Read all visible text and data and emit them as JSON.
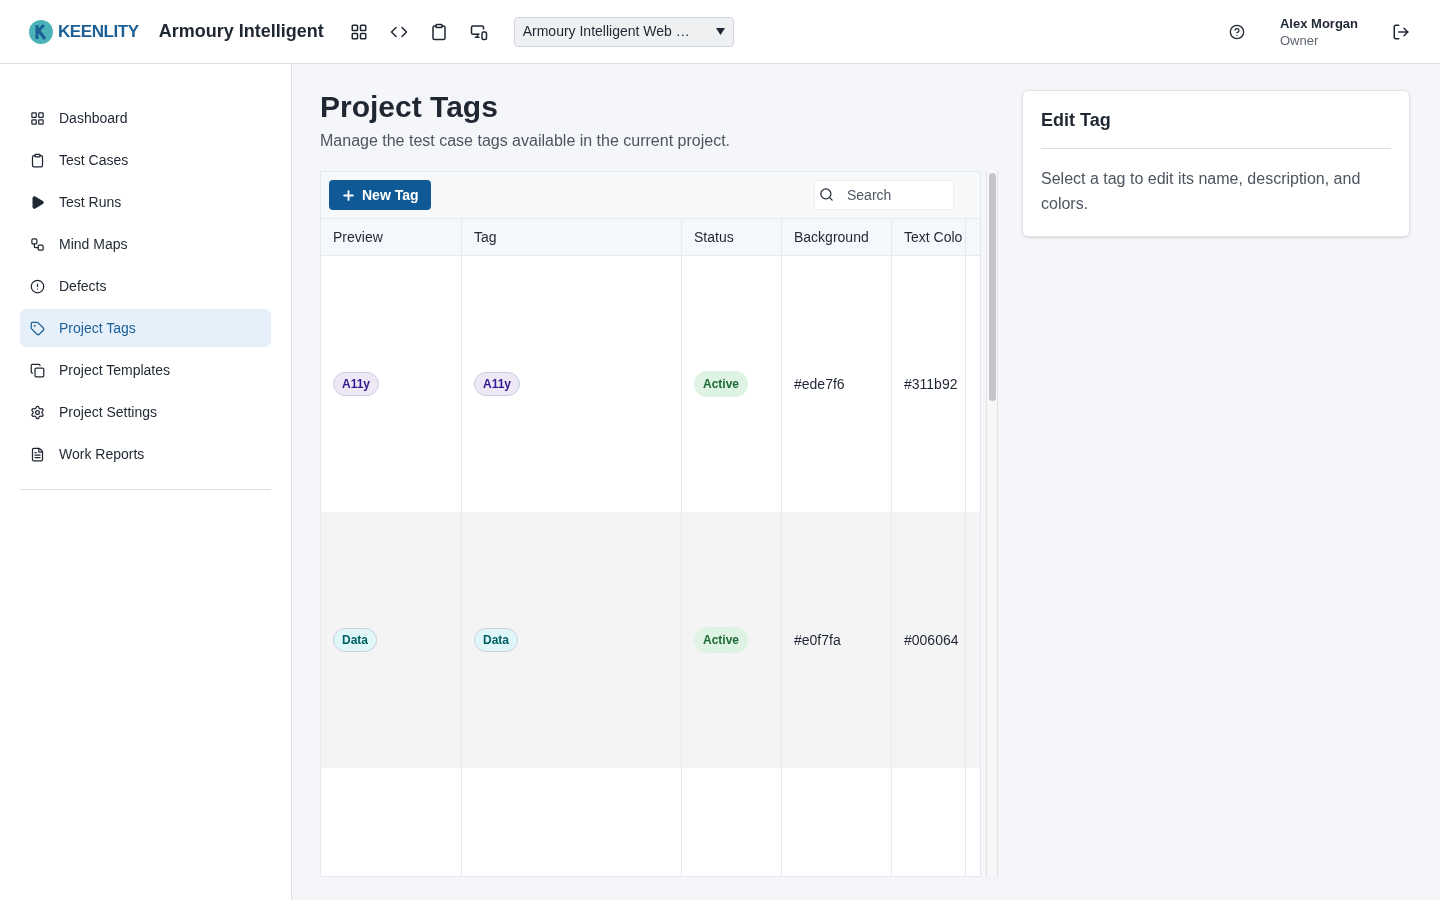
{
  "header": {
    "logo": "KEENLITY",
    "app_title": "Armoury Intelligent",
    "project_select": "Armoury Intelligent Web …",
    "user": {
      "name": "Alex Morgan",
      "role": "Owner"
    }
  },
  "sidebar": {
    "items": [
      {
        "label": "Dashboard",
        "selected": false
      },
      {
        "label": "Test Cases",
        "selected": false
      },
      {
        "label": "Test Runs",
        "selected": false
      },
      {
        "label": "Mind Maps",
        "selected": false
      },
      {
        "label": "Defects",
        "selected": false
      },
      {
        "label": "Project Tags",
        "selected": true
      },
      {
        "label": "Project Templates",
        "selected": false
      },
      {
        "label": "Project Settings",
        "selected": false
      },
      {
        "label": "Work Reports",
        "selected": false
      }
    ]
  },
  "page": {
    "title": "Project Tags",
    "subtitle": "Manage the test case tags available in the current project."
  },
  "toolbar": {
    "new_button": "New Tag",
    "search": {
      "placeholder": "Search"
    }
  },
  "table": {
    "columns": [
      "Preview",
      "Tag",
      "Status",
      "Background",
      "Text Colo"
    ],
    "rows": [
      {
        "preview": "A11y",
        "tag": "A11y",
        "status": "Active",
        "background": "#ede7f6",
        "text_color": "#311b92"
      },
      {
        "preview": "Data",
        "tag": "Data",
        "status": "Active",
        "background": "#e0f7fa",
        "text_color": "#006064"
      }
    ]
  },
  "edit_panel": {
    "title": "Edit Tag",
    "message": "Select a tag to edit its name, description, and colors."
  }
}
